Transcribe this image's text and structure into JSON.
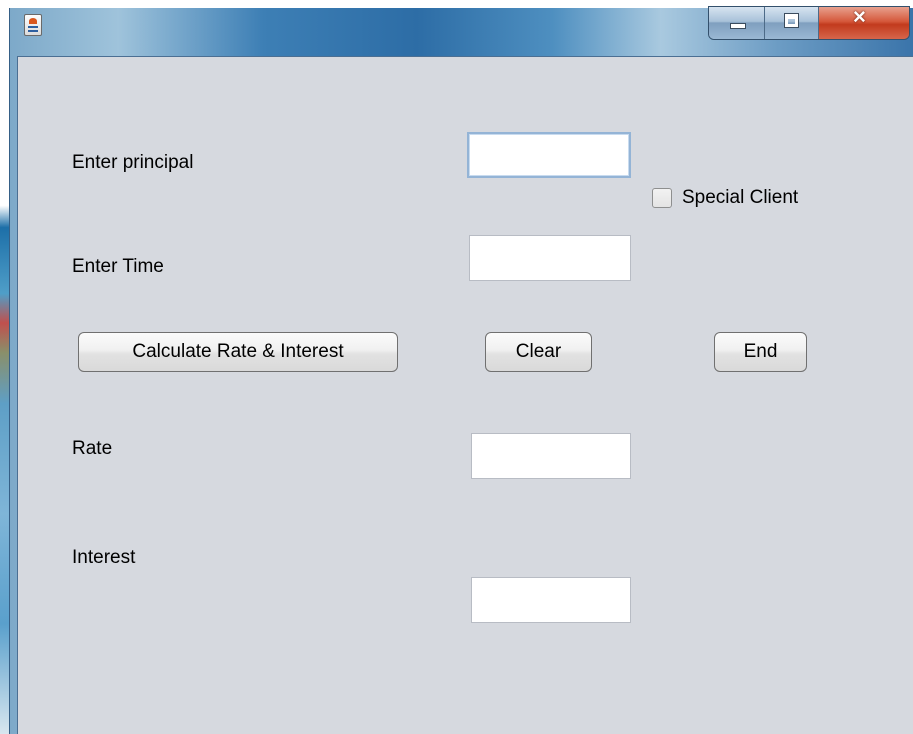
{
  "window": {
    "title": "",
    "controls": {
      "minimize": "minimize",
      "maximize": "maximize",
      "close": "×"
    }
  },
  "form": {
    "principal_label": "Enter principal",
    "principal_value": "",
    "time_label": "Enter Time",
    "time_value": "",
    "special_client_label": "Special Client",
    "special_client_checked": false,
    "rate_label": "Rate",
    "rate_value": "",
    "interest_label": "Interest",
    "interest_value": ""
  },
  "buttons": {
    "calculate": "Calculate Rate & Interest",
    "clear": "Clear",
    "end": "End"
  },
  "colors": {
    "client_bg": "#d6d9df",
    "close_button": "#c94a2c",
    "focus_border": "#94b4d6"
  }
}
